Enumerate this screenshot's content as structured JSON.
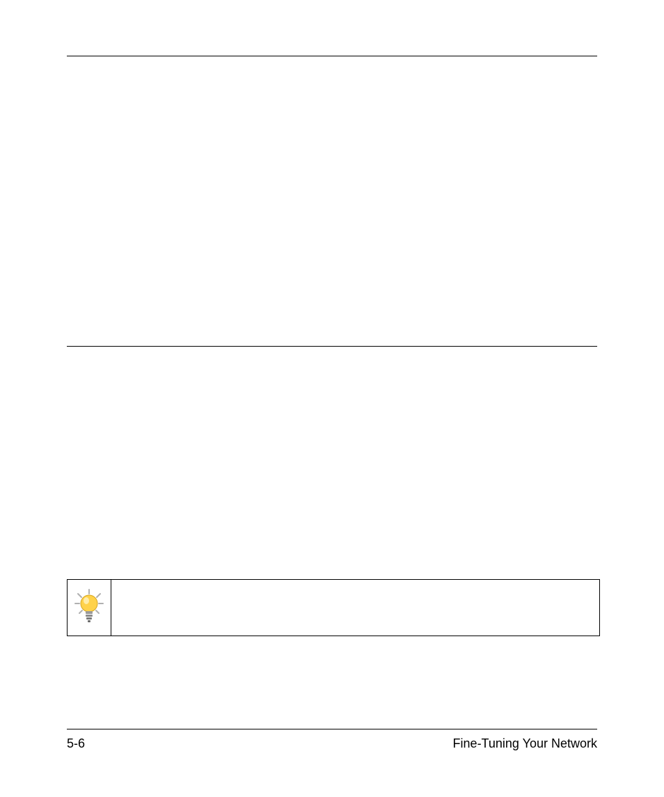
{
  "footer": {
    "page_number": "5-6",
    "section_title": "Fine-Tuning Your Network"
  },
  "tip": {
    "icon": "lightbulb-icon",
    "text": ""
  }
}
